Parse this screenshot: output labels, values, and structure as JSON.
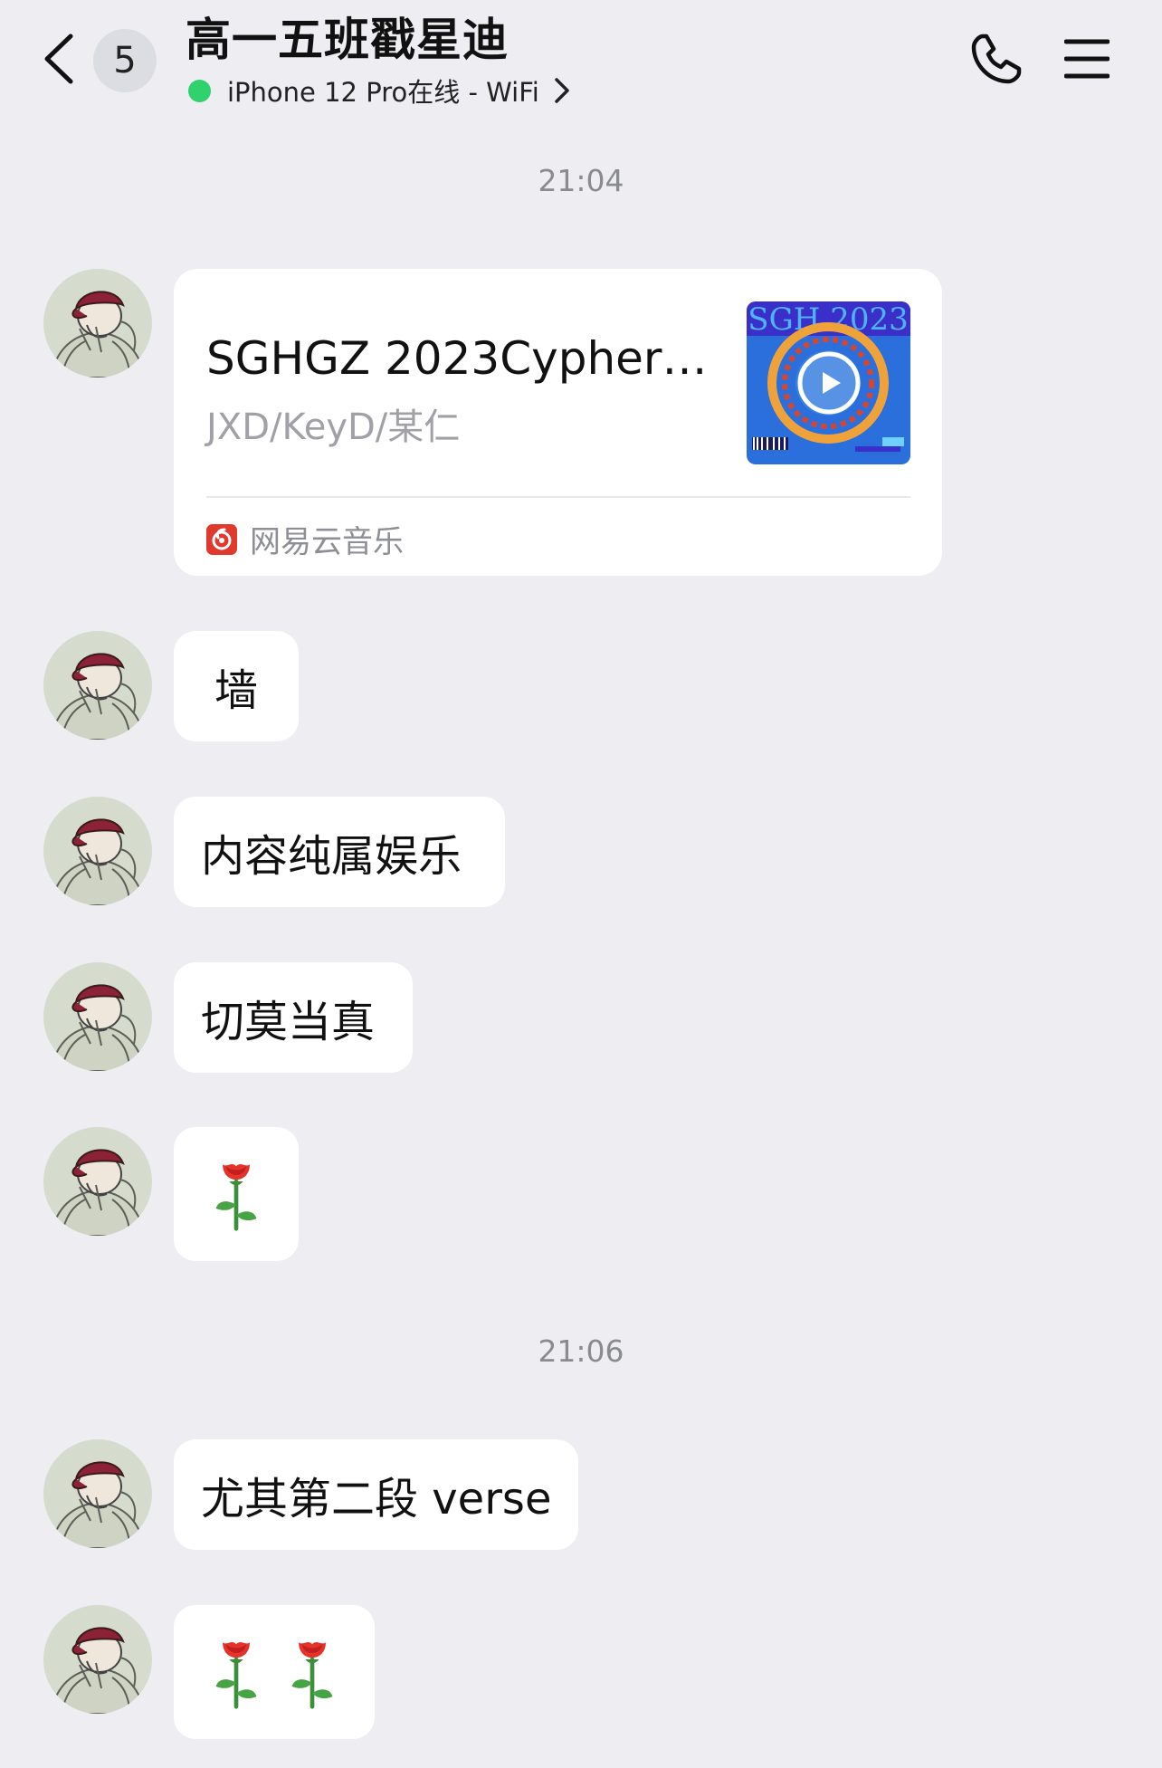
{
  "header": {
    "unread_count": "5",
    "title": "高一五班戳星迪",
    "status": "iPhone 12 Pro在线 - WiFi"
  },
  "timestamps": [
    "21:04",
    "21:06"
  ],
  "music_card": {
    "title": "SGHGZ 2023Cypher…",
    "artist": "JXD/KeyD/某仁",
    "cover_text": "SGH 2023",
    "source": "网易云音乐"
  },
  "messages": [
    {
      "text": "墙"
    },
    {
      "text": "内容纯属娱乐"
    },
    {
      "text": "切莫当真"
    },
    {
      "emoji": "rose",
      "count": 1
    },
    {
      "text": "尤其第二段 verse"
    },
    {
      "emoji": "rose",
      "count": 2
    }
  ],
  "colors": {
    "background": "#ededf2",
    "bubble": "#ffffff",
    "online_dot": "#2fd26c",
    "netease_red": "#e03a2f",
    "cover_blue": "#2a6fdc"
  }
}
